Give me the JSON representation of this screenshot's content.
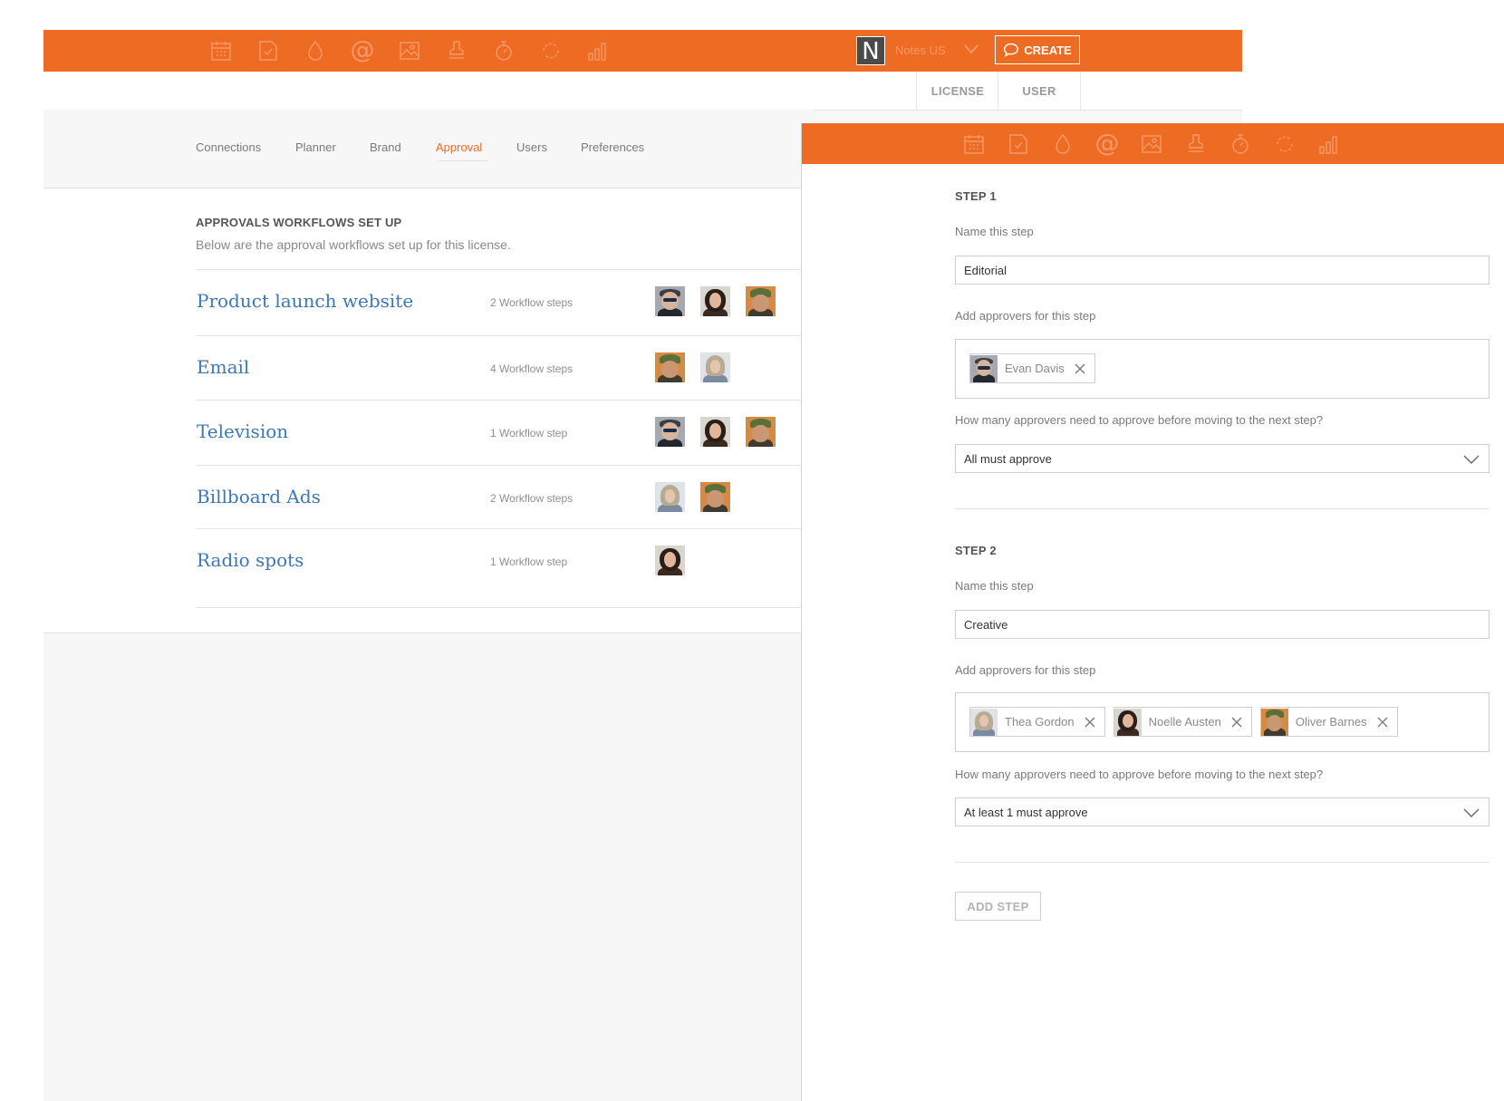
{
  "top_bar": {
    "nav_icons": [
      "calendar-icon",
      "task-icon",
      "drop-icon",
      "at-icon",
      "image-icon",
      "stamp-icon",
      "stopwatch-icon",
      "refresh-icon",
      "bar-chart-icon"
    ],
    "logo_letter": "N",
    "account_name": "Notes US",
    "create_label": "CREATE"
  },
  "sub_tabs": {
    "license": "LICENSE",
    "user": "USER"
  },
  "settings_nav": {
    "tabs": [
      "Connections",
      "Planner",
      "Brand",
      "Approval",
      "Users",
      "Preferences"
    ],
    "active": "Approval"
  },
  "approvals": {
    "title": "APPROVALS WORKFLOWS SET UP",
    "subtitle": "Below are the approval workflows set up for this license.",
    "workflows": [
      {
        "name": "Product launch website",
        "steps": "2 Workflow steps",
        "approvers": [
          "Evan Davis",
          "Noelle Austen",
          "Oliver Barnes"
        ]
      },
      {
        "name": "Email",
        "steps": "4 Workflow steps",
        "approvers": [
          "Oliver Barnes",
          "Thea Gordon"
        ]
      },
      {
        "name": "Television",
        "steps": "1 Workflow step",
        "approvers": [
          "Evan Davis",
          "Noelle Austen",
          "Oliver Barnes"
        ]
      },
      {
        "name": "Billboard Ads",
        "steps": "2 Workflow steps",
        "approvers": [
          "Thea Gordon",
          "Oliver Barnes"
        ]
      },
      {
        "name": "Radio spots",
        "steps": "1 Workflow step",
        "approvers": [
          "Noelle Austen"
        ]
      }
    ]
  },
  "editor": {
    "steps": [
      {
        "label": "STEP 1",
        "name_label": "Name this step",
        "name_value": "Editorial",
        "approvers_label": "Add approvers for this step",
        "approvers": [
          "Evan Davis"
        ],
        "rule_label": "How many approvers need to approve before moving to the next step?",
        "rule_value": "All must approve"
      },
      {
        "label": "STEP 2",
        "name_label": "Name this step",
        "name_value": "Creative",
        "approvers_label": "Add approvers for this step",
        "approvers": [
          "Thea Gordon",
          "Noelle Austen",
          "Oliver Barnes"
        ],
        "rule_label": "How many approvers need to approve before moving to the next step?",
        "rule_value": "At least 1 must approve"
      }
    ],
    "add_step_label": "ADD STEP"
  },
  "colors": {
    "brand_orange": "#ee6b24",
    "link_blue": "#3c78b5"
  }
}
